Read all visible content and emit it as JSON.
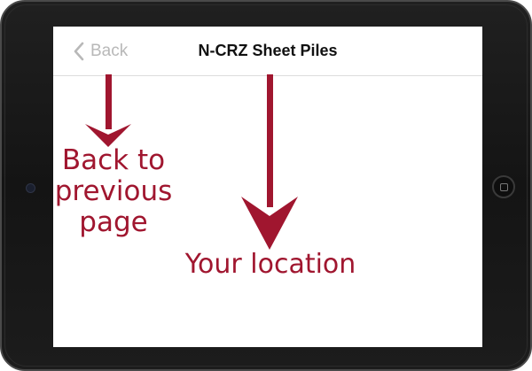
{
  "device": {
    "frame_color": "#1a1a1a"
  },
  "navbar": {
    "back_label": "Back",
    "back_icon": "chevron-left-icon",
    "title": "N-CRZ Sheet Piles"
  },
  "annotations": {
    "color": "#a0162f",
    "back_note": "Back to previous page",
    "location_note": "Your location"
  }
}
